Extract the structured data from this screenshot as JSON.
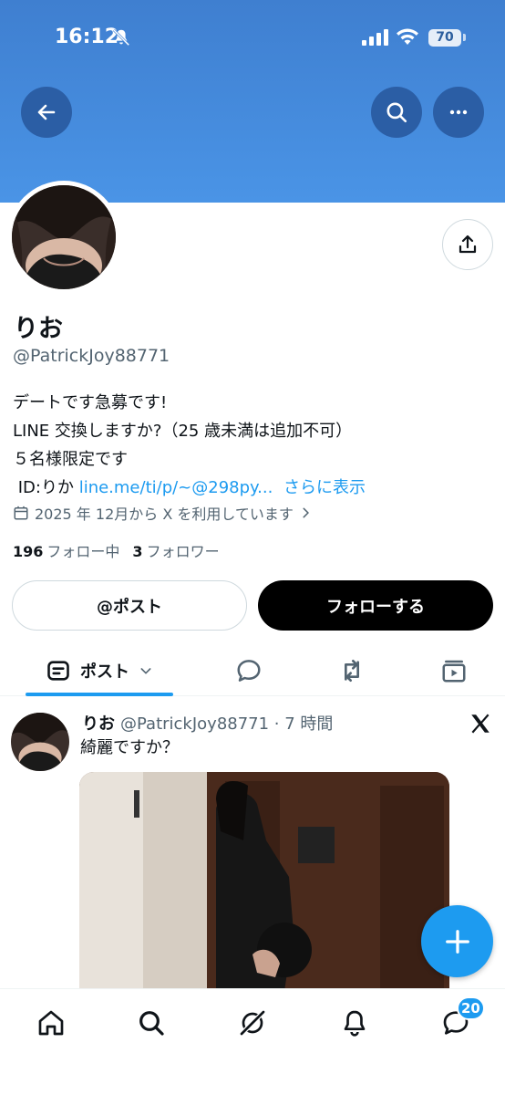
{
  "status_bar": {
    "time": "16:12",
    "battery": "70"
  },
  "profile": {
    "display_name": "りお",
    "handle": "@PatrickJoy88771",
    "bio": {
      "line1": "デートです急募です!",
      "line2": "LINE 交換しますか?（25 歳未満は追加不可）",
      "line3": "５名様限定です",
      "line4_prefix": " ID:りか ",
      "link": "line.me/ti/p/~@298py...",
      "show_more": "さらに表示"
    },
    "joined": "2025 年 12月から X を利用しています",
    "following_count": "196",
    "following_label": "フォロー中",
    "followers_count": "3",
    "followers_label": "フォロワー"
  },
  "actions": {
    "post_label": "@ポスト",
    "follow_label": "フォローする"
  },
  "tabs": {
    "posts_label": "ポスト"
  },
  "tweet": {
    "name": "りお",
    "handle_time": "@PatrickJoy88771 · 7 時間",
    "text": "綺麗ですか？"
  },
  "nav": {
    "messages_badge": "20"
  },
  "colors": {
    "accent": "#1d9bf0",
    "banner": "#4a94e6",
    "text": "#0f1419",
    "muted": "#536471"
  },
  "icons": [
    "bell-off-icon",
    "signal-icon",
    "wifi-icon",
    "battery-icon",
    "back-arrow-icon",
    "search-icon",
    "more-icon",
    "share-icon",
    "calendar-icon",
    "chevron-right-icon",
    "post-tab-icon",
    "chevron-down-icon",
    "replies-icon",
    "repost-icon",
    "media-icon",
    "x-logo-icon",
    "plus-icon",
    "home-icon",
    "grok-icon",
    "bell-icon",
    "messages-icon"
  ]
}
